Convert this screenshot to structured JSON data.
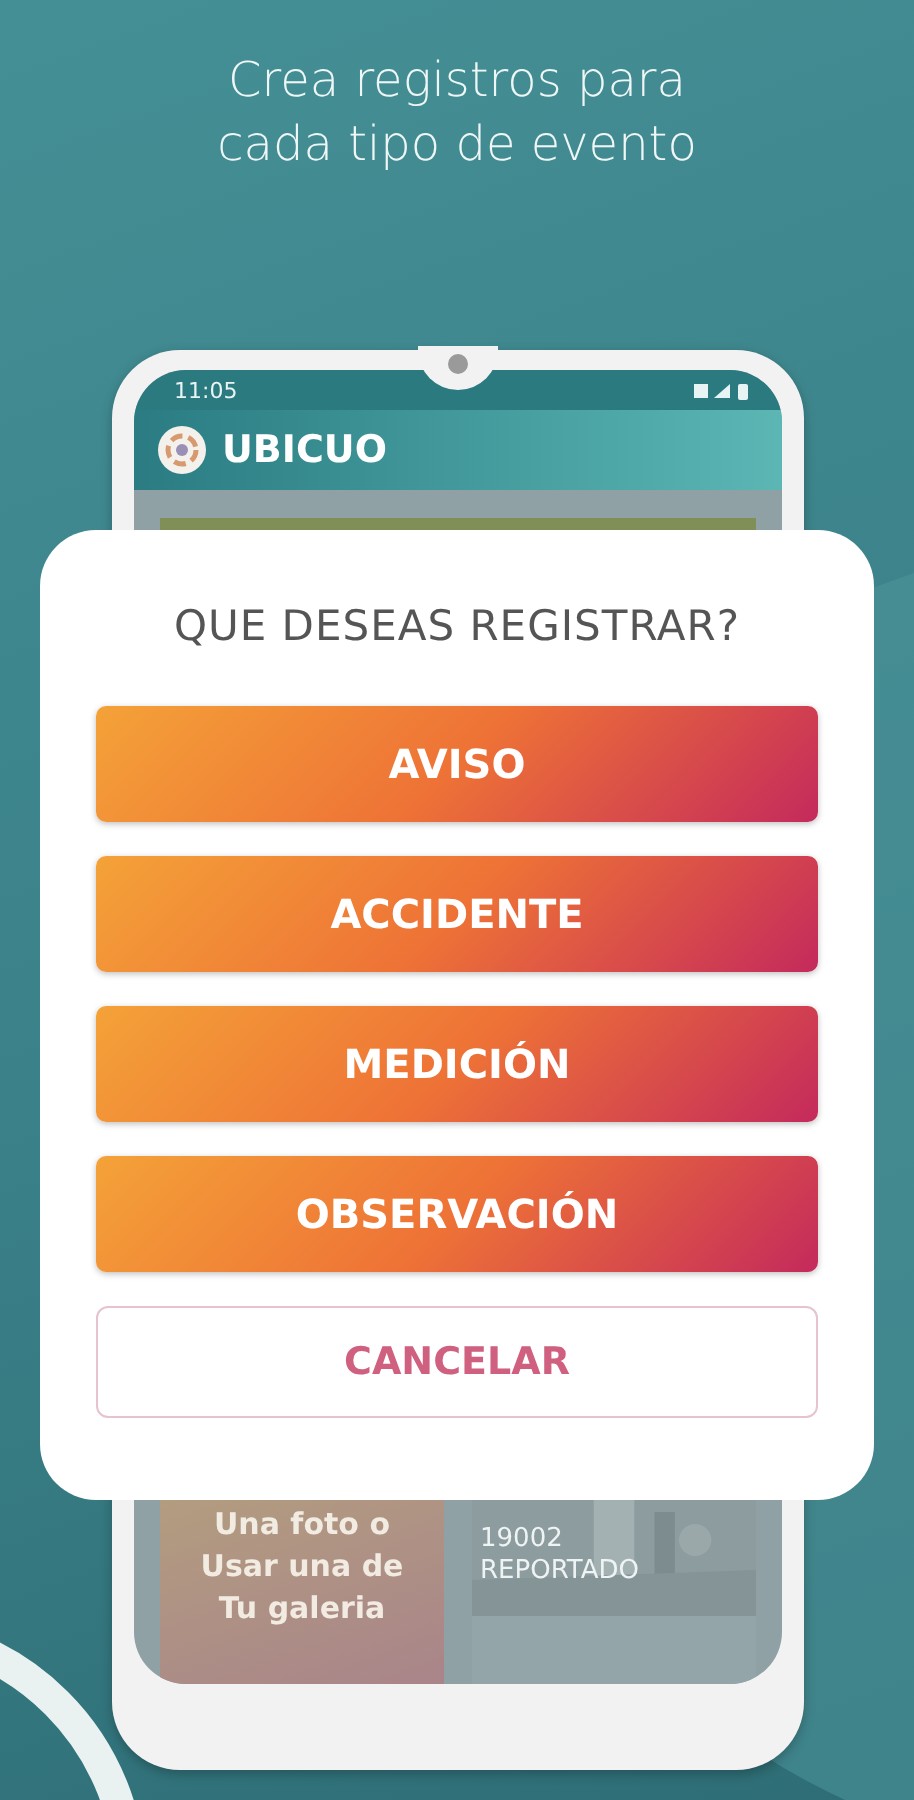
{
  "headline": "Crea registros para cada tipo de evento",
  "phone": {
    "time": "11:05",
    "app_title": "UBICUO",
    "cards": [
      {
        "kind": "prompt",
        "lines": [
          "Una foto o",
          "Usar una de",
          "Tu galeria"
        ]
      },
      {
        "kind": "report",
        "number": "19002",
        "status": "REPORTADO"
      }
    ]
  },
  "dialog": {
    "title": "QUE DESEAS REGISTRAR?",
    "options": [
      {
        "label": "AVISO",
        "kind": "option"
      },
      {
        "label": "ACCIDENTE",
        "kind": "option"
      },
      {
        "label": "MEDICIÓN",
        "kind": "option"
      },
      {
        "label": "OBSERVACIÓN",
        "kind": "option"
      },
      {
        "label": "CANCELAR",
        "kind": "cancel"
      }
    ]
  }
}
